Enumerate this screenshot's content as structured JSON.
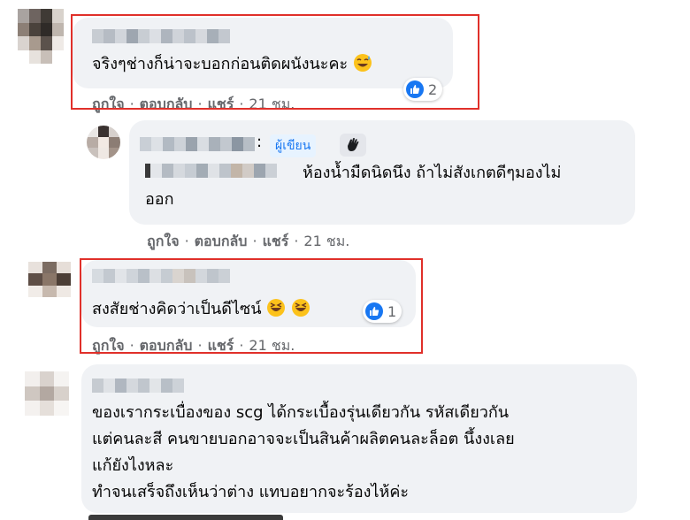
{
  "comments": [
    {
      "name_label": "Kevlo Saphanee",
      "text": "จริงๆช่างก็น่าจะบอกก่อนติดผนังนะคะ",
      "emoji": "grinning-sweat-emoji",
      "reaction_count": "2",
      "actions": {
        "like": "ถูกใจ",
        "reply": "ตอบกลับ",
        "share": "แชร์",
        "time": "21 ชม."
      }
    },
    {
      "author_badge": "ผู้เขียน",
      "text_lines": [
        "ห้องน้ำมืดนิดนึง ถ้าไม่สังเกตดีๆมองไม่",
        "ออก"
      ],
      "actions": {
        "like": "ถูกใจ",
        "reply": "ตอบกลับ",
        "share": "แชร์",
        "time": "21 ชม."
      }
    },
    {
      "text": "สงสัยช่างคิดว่าเป็นดีไซน์",
      "emoji": "laughing-emoji",
      "reaction_count": "1",
      "actions": {
        "like": "ถูกใจ",
        "reply": "ตอบกลับ",
        "share": "แชร์",
        "time": "21 ชม."
      }
    },
    {
      "text_lines": [
        "ของเรากระเบื่องของ scg ได้กระเบื้องรุ่นเดียวกัน รหัสเดียวกัน",
        "แต่คนละสี คนขายบอกอาจจะเป็นสินค้าผลิตคนละล็อต นึ้งงเลย",
        "แก้ยังไงหละ",
        "ทำจนเสร็จถึงเห็นว่าต่าง แทบอยากจะร้องไห้ค่ะ"
      ]
    }
  ],
  "colors": {
    "bubble": "#f0f2f5",
    "action_text": "#65676b",
    "highlight": "#e0302a",
    "like_blue": "#1877f2",
    "author_badge_bg": "#e7f3ff"
  }
}
